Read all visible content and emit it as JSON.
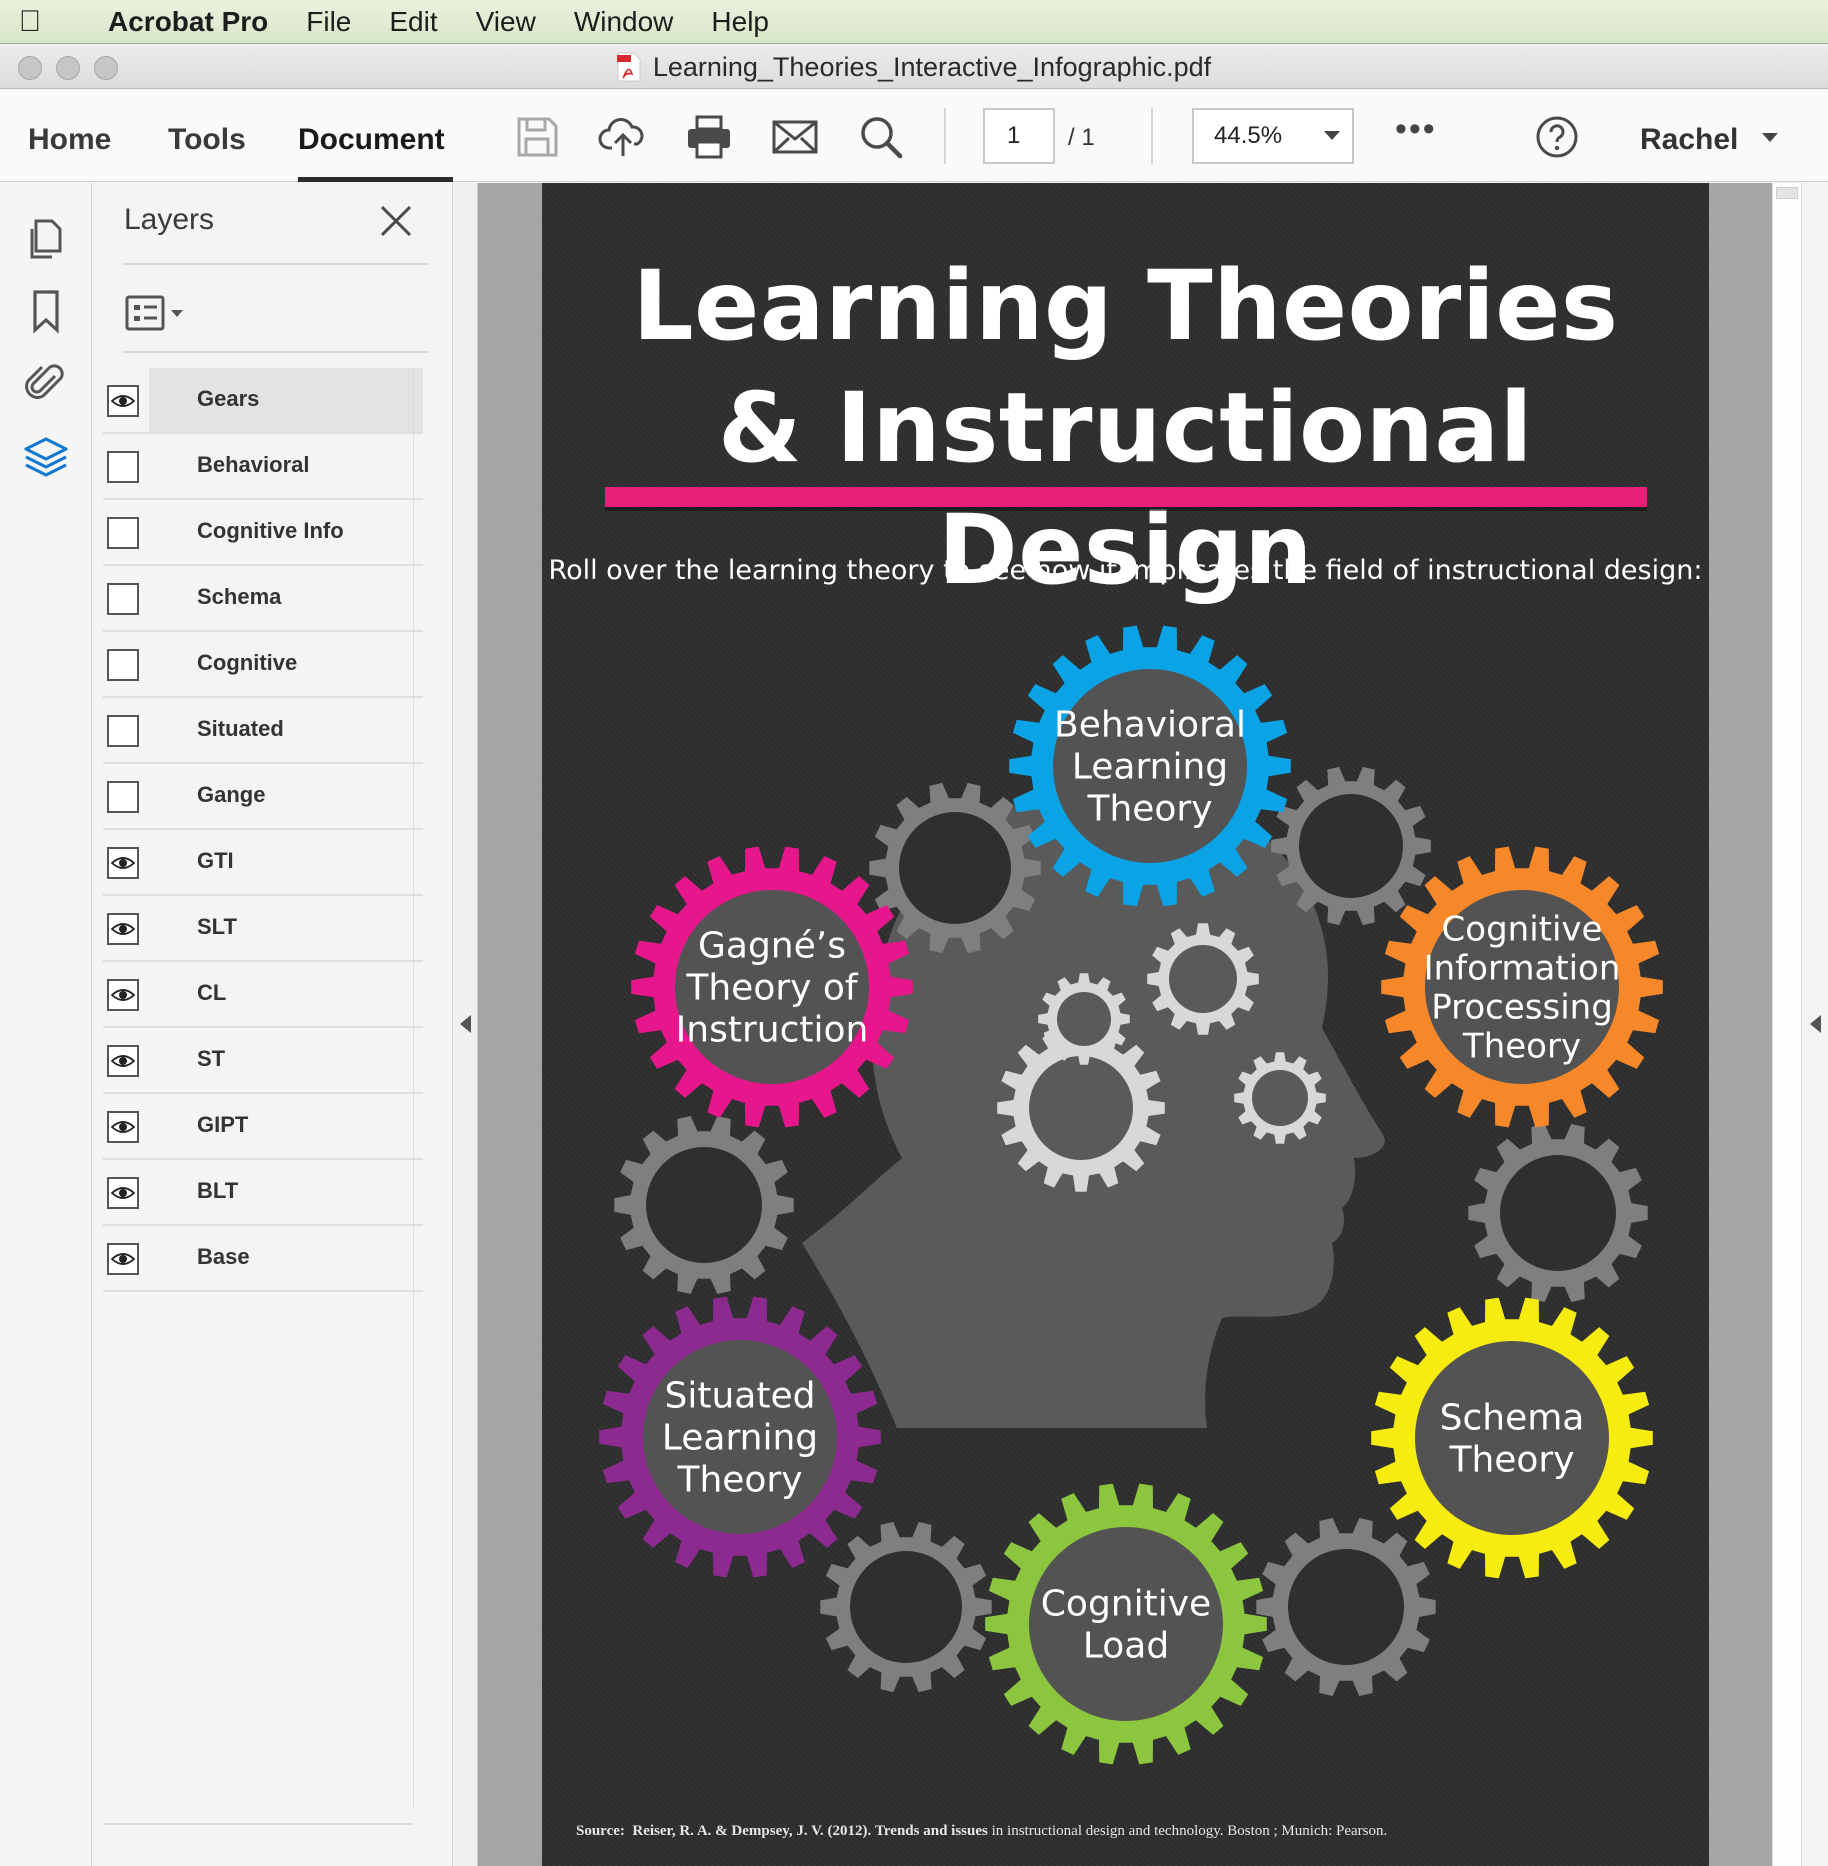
{
  "menubar": {
    "app_name": "Acrobat Pro",
    "items": [
      "File",
      "Edit",
      "View",
      "Window",
      "Help"
    ]
  },
  "window": {
    "title": "Learning_Theories_Interactive_Infographic.pdf"
  },
  "toolbar": {
    "tabs": [
      "Home",
      "Tools",
      "Document"
    ],
    "active_tab": "Document",
    "page_current": "1",
    "page_total": "/ 1",
    "zoom": "44.5%",
    "more": "•••",
    "user": "Rachel",
    "icons": [
      "save-icon",
      "upload-cloud-icon",
      "print-icon",
      "mail-icon",
      "search-icon",
      "help-icon"
    ]
  },
  "rail": {
    "icons": [
      "pages-icon",
      "bookmark-icon",
      "attachment-icon",
      "layers-icon"
    ],
    "active": "layers-icon"
  },
  "layers_panel": {
    "title": "Layers",
    "layers": [
      {
        "label": "Gears",
        "visible": true,
        "selected": true
      },
      {
        "label": "Behavioral",
        "visible": false
      },
      {
        "label": "Cognitive Info",
        "visible": false
      },
      {
        "label": "Schema",
        "visible": false
      },
      {
        "label": "Cognitive",
        "visible": false
      },
      {
        "label": "Situated",
        "visible": false
      },
      {
        "label": "Gange",
        "visible": false
      },
      {
        "label": "GTI",
        "visible": true
      },
      {
        "label": "SLT",
        "visible": true
      },
      {
        "label": "CL",
        "visible": true
      },
      {
        "label": "ST",
        "visible": true
      },
      {
        "label": "GIPT",
        "visible": true
      },
      {
        "label": "BLT",
        "visible": true
      },
      {
        "label": "Base",
        "visible": true
      }
    ]
  },
  "document": {
    "title_line1": "Learning Theories",
    "title_line2": "& Instructional Design",
    "subtitle": "Roll over the learning theory to see how it implicates the field of instructional design:",
    "theories": [
      {
        "id": "behavioral",
        "lines": [
          "Behavioral",
          "Learning",
          "Theory"
        ],
        "color": "#0aa3e6"
      },
      {
        "id": "cognitive-info",
        "lines": [
          "Cognitive",
          "Information",
          "Processing",
          "Theory"
        ],
        "color": "#f7882a"
      },
      {
        "id": "schema",
        "lines": [
          "Schema",
          "Theory"
        ],
        "color": "#f6ec0f"
      },
      {
        "id": "cognitive-load",
        "lines": [
          "Cognitive",
          "Load"
        ],
        "color": "#8cc63f"
      },
      {
        "id": "situated",
        "lines": [
          "Situated",
          "Learning",
          "Theory"
        ],
        "color": "#8c2a8f"
      },
      {
        "id": "gagne",
        "lines": [
          "Gagné’s",
          "Theory of",
          "Instruction"
        ],
        "color": "#e6178c"
      }
    ],
    "source_label": "Source:",
    "source_authors": "Reiser, R. A. & Dempsey, J. V. (2012).",
    "source_title": "Trends and issues",
    "source_rest": "in instructional design and technology. Boston ; Munich: Pearson."
  }
}
